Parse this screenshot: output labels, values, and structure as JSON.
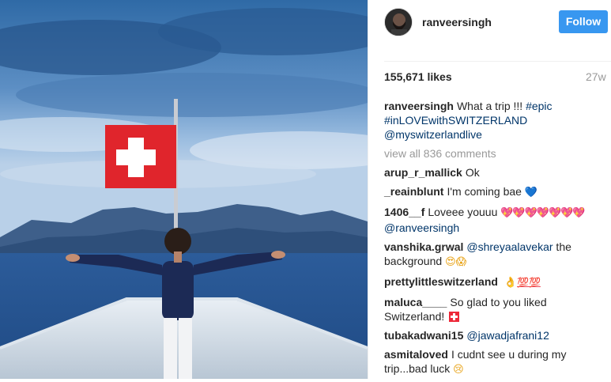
{
  "post": {
    "username": "ranveersingh",
    "follow_label": "Follow",
    "likes": "155,671 likes",
    "age": "27w",
    "caption": {
      "user": "ranveersingh",
      "text": "What a trip !!! ",
      "tag1": "#epic",
      "tag2": "#inLOVEwithSWITZERLAND",
      "tag3": "@myswitzerlandlive"
    },
    "view_all": "view all 836 comments"
  },
  "comments": [
    {
      "user": "arup_r_mallick",
      "text": "Ok"
    },
    {
      "user": "_reainblunt",
      "text": "I'm coming bae",
      "emoji": "💙"
    },
    {
      "user": "1406__f",
      "text": "Loveee youuu",
      "emoji": "💖💖💖💖💖💖💖",
      "mention": "@ranveersingh"
    },
    {
      "user": "vanshika.grwal",
      "mention": "@shreyaalavekar",
      "text": " the background",
      "emoji": "😍😱"
    },
    {
      "user": "prettylittleswitzerland",
      "emoji": "👌",
      "emoji2": "💯💯"
    },
    {
      "user": "maluca____",
      "text": "So glad to you liked Switzerland!"
    },
    {
      "user": "tubakadwani15",
      "mention": "@jawadjafrani12"
    },
    {
      "user": "asmitaloved",
      "text": "I cudnt see u during my trip...bad luck",
      "emoji": "😢"
    }
  ],
  "icons": {
    "avatar": "avatar-photo",
    "flag": "swiss-flag-icon"
  },
  "colors": {
    "follow_bg": "#3897f0",
    "link": "#003569",
    "muted": "#999999"
  }
}
